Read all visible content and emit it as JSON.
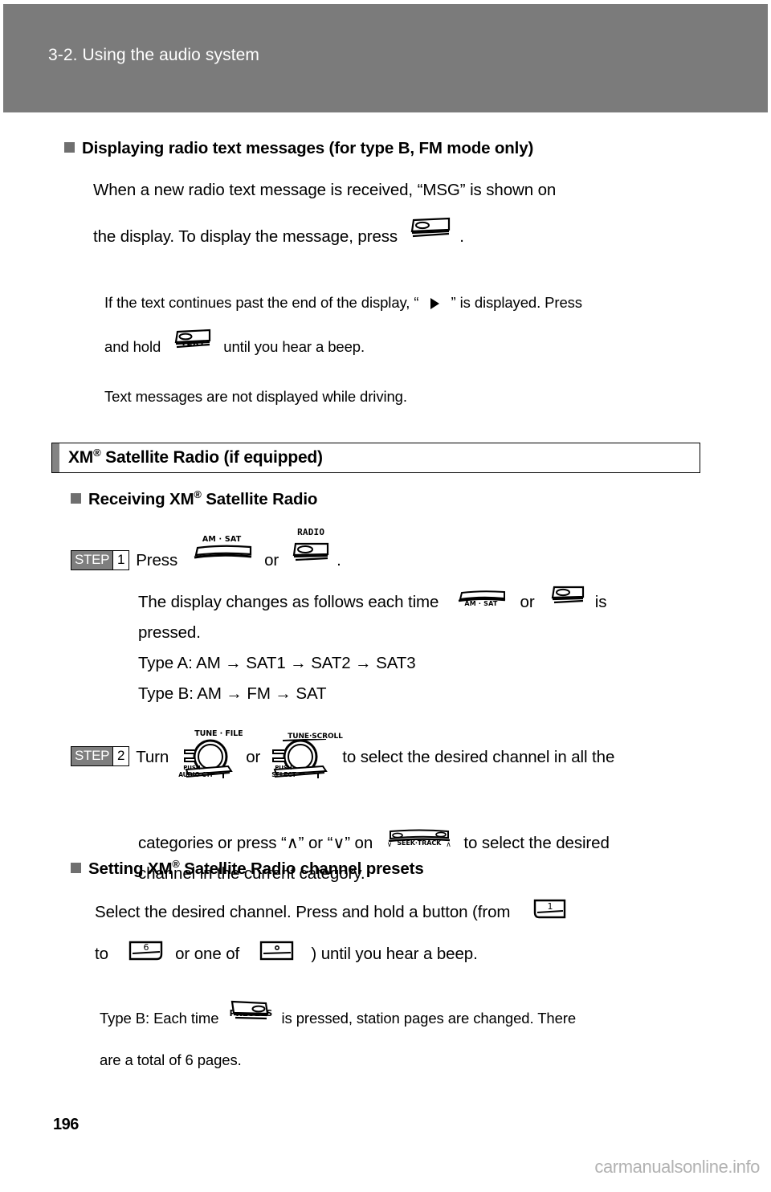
{
  "header": {
    "title": "3-2. Using the audio system"
  },
  "sections": [
    {
      "id": "radio-text",
      "heading": "Displaying radio text messages (for type B, FM mode only)",
      "body_part1": "When a new radio text message is received, “MSG” is shown on",
      "body_part2_a": "the display. To display the message, press",
      "body_part2_b": ".",
      "notes": [
        {
          "a": "If the text continues past the end of the display, “",
          "b": "” is displayed. Press",
          "c": "and hold",
          "d": "until you hear a beep."
        },
        {
          "text": "Text messages are not displayed while driving."
        }
      ]
    }
  ],
  "xm_section": {
    "box_title_a": "XM",
    "box_title_reg": "®",
    "box_title_b": " Satellite Radio (if equipped)",
    "receiving_heading_a": "Receiving XM",
    "receiving_heading_reg": "®",
    "receiving_heading_b": " Satellite Radio",
    "step1": {
      "badge_word": "STEP",
      "badge_num": "1",
      "text_a": "Press",
      "text_or": "or",
      "text_end": ".",
      "detail_a": "The display changes as follows each time",
      "detail_or": "or",
      "detail_is": "is",
      "detail_b": "pressed.",
      "type_a": "Type A: AM → SAT1 → SAT2 → SAT3",
      "type_b": "Type B: AM → FM → SAT"
    },
    "step2": {
      "badge_word": "STEP",
      "badge_num": "2",
      "text_a": "Turn",
      "text_or": "or",
      "text_b": "to select the desired channel in all the",
      "line2_a": "categories or press “∧” or “∨” on",
      "line2_b": "to select the desired",
      "line3": "channel in the current category."
    },
    "presets_heading_a": "Setting XM",
    "presets_heading_reg": "®",
    "presets_heading_b": " Satellite Radio channel presets",
    "presets_body_a": "Select the desired channel. Press and hold a button (from",
    "presets_body_to": "to",
    "presets_body_or": "or one of",
    "presets_body_end": ") until you hear a beep.",
    "type_b_note_a": "Type B: Each time",
    "type_b_note_b": "is pressed, station pages are changed. There",
    "type_b_note_c": "are a total of 6 pages."
  },
  "icons": {
    "text_button": "TEXT",
    "radio_button": "RADIO",
    "am_sat_button": "AM · SAT",
    "presets_button": "PRESETS",
    "tune_file_knob": "TUNE · FILE",
    "tune_file_push": "PUSH",
    "tune_file_push2": "AUDIO CTRL",
    "tune_scroll_knob": "TUNE·SCROLL",
    "tune_scroll_push": "PUSH",
    "tune_scroll_push2": "SELECT",
    "seek_track": "SEEK·TRACK",
    "seek_down": "∨",
    "seek_up": "∧",
    "preset_1": "1",
    "preset_6": "6",
    "preset_dot": "◦",
    "arrow_right": "▶"
  },
  "footer": {
    "page_number": "196",
    "watermark": "carmanualsonline.info"
  },
  "colors": {
    "header_bg": "#7b7b7b",
    "bullet_square": "#6f6f6f",
    "step_badge_bg": "#7e7e7e",
    "section_bar": "#848484",
    "watermark": "#b2b2b2"
  }
}
